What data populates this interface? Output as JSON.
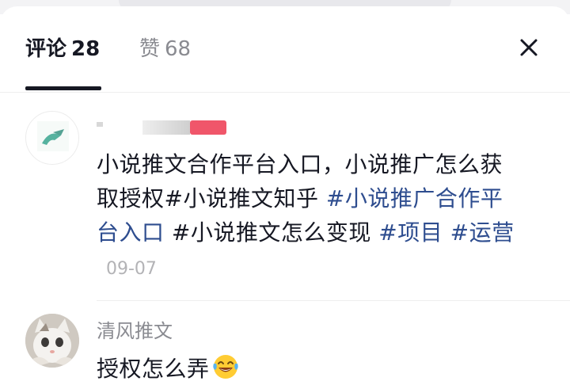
{
  "tabs": {
    "comments_label": "评论",
    "comments_count": "28",
    "likes_label": "赞",
    "likes_count": "68"
  },
  "comments": [
    {
      "username": "",
      "segments": [
        {
          "text": "小说推文合作平台入口，小说推广怎么获取授权#小说推文知乎 ",
          "hashtag": false
        },
        {
          "text": "#小说推广合作平台入口",
          "hashtag": true
        },
        {
          "text": " #小说推文怎么变现 ",
          "hashtag": false
        },
        {
          "text": "#项目",
          "hashtag": true
        },
        {
          "text": " ",
          "hashtag": false
        },
        {
          "text": "#运营",
          "hashtag": true
        }
      ],
      "date": "09-07"
    },
    {
      "username": "清风推文",
      "text": "授权怎么弄",
      "emoji": "laughing-crying-emoji"
    }
  ],
  "icons": {
    "close": "close-icon"
  },
  "colors": {
    "hashtag": "#2e4d8f",
    "secondary_text": "#8a8b91",
    "primary_text": "#161823"
  }
}
